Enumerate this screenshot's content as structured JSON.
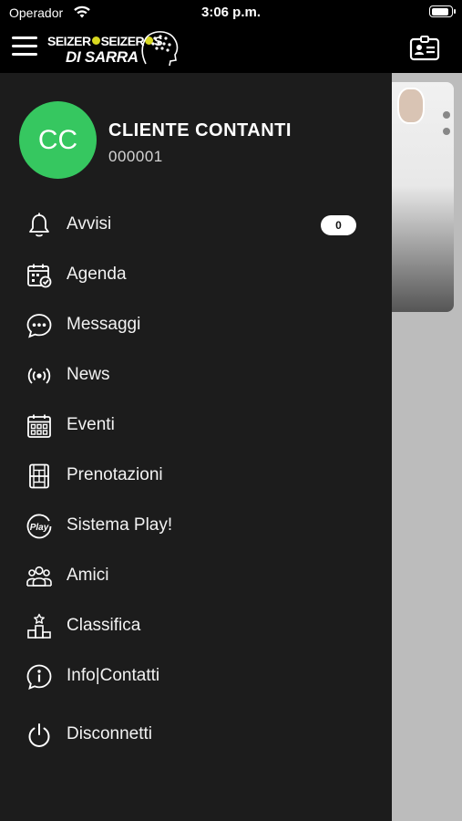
{
  "status_bar": {
    "carrier": "Operador",
    "time": "3:06 p.m.",
    "battery_level": 0.9
  },
  "header": {
    "menu_icon": "hamburger-icon",
    "logo": {
      "line1_a": "SEIZER",
      "line1_b": "SEIZER",
      "line1_c": "S",
      "line2": "DI SARRA"
    },
    "profile_card_icon": "id-card-icon"
  },
  "drawer": {
    "user": {
      "initials": "CC",
      "name": "CLIENTE CONTANTI",
      "code": "000001",
      "avatar_color": "#36c760"
    },
    "items": [
      {
        "label": "Avvisi",
        "icon": "bell-icon",
        "badge": "0"
      },
      {
        "label": "Agenda",
        "icon": "calendar-check-icon"
      },
      {
        "label": "Messaggi",
        "icon": "chat-bubble-icon"
      },
      {
        "label": "News",
        "icon": "broadcast-icon"
      },
      {
        "label": "Eventi",
        "icon": "calendar-grid-icon"
      },
      {
        "label": "Prenotazioni",
        "icon": "court-booking-icon"
      },
      {
        "label": "Sistema Play!",
        "icon": "play-logo-icon"
      },
      {
        "label": "Amici",
        "icon": "friends-icon"
      },
      {
        "label": "Classifica",
        "icon": "podium-icon"
      },
      {
        "label": "Info|Contatti",
        "icon": "info-icon"
      },
      {
        "label": "Disconnetti",
        "icon": "power-icon"
      }
    ]
  },
  "colors": {
    "drawer_background": "#1c1c1c",
    "header_background": "#000000",
    "overlay_background": "#bcbcbc"
  }
}
